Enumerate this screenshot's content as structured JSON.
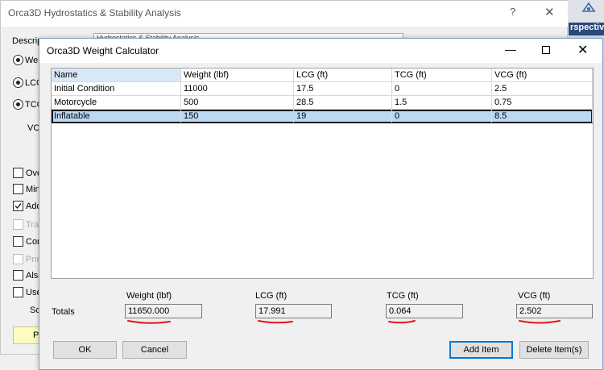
{
  "background_window": {
    "title": "Orca3D Hydrostatics & Stability Analysis",
    "help_glyph": "?",
    "close_glyph": "✕",
    "description_label": "Descrip",
    "description_value": "Hydrostatics & Stability Analysis",
    "radios": [
      "Wei",
      "LCG",
      "TCG"
    ],
    "vc_label": "VC",
    "checkboxes": [
      {
        "label": "Ove",
        "disabled": false,
        "checked": false
      },
      {
        "label": "Mini",
        "disabled": false,
        "checked": false
      },
      {
        "label": "Add",
        "disabled": false,
        "checked": true
      },
      {
        "label": "Tra",
        "disabled": true,
        "checked": false
      },
      {
        "label": "Con",
        "disabled": false,
        "checked": false
      },
      {
        "label": "Prin",
        "disabled": true,
        "checked": false
      },
      {
        "label": "Also",
        "disabled": false,
        "checked": false
      },
      {
        "label": "Use",
        "disabled": false,
        "checked": false
      }
    ],
    "so_label": "So",
    "yellow_button_label": "Pe"
  },
  "side_app": {
    "tab_label": "rspectiv",
    "icon": "app-tool-icon"
  },
  "dialog": {
    "title": "Orca3D Weight Calculator",
    "minimize_glyph": "—",
    "close_glyph": "✕",
    "table": {
      "headers": [
        "Name",
        "Weight (lbf)",
        "LCG (ft)",
        "TCG (ft)",
        "VCG (ft)"
      ],
      "rows": [
        [
          "Initial Condition",
          "11000",
          "17.5",
          "0",
          "2.5"
        ],
        [
          "Motorcycle",
          "500",
          "28.5",
          "1.5",
          "0.75"
        ],
        [
          "Inflatable",
          "150",
          "19",
          "0",
          "8.5"
        ]
      ],
      "selected_row": 2
    },
    "totals": {
      "label": "Totals",
      "weight_label": "Weight (lbf)",
      "weight_value": "11650.000",
      "lcg_label": "LCG (ft)",
      "lcg_value": "17.991",
      "tcg_label": "TCG (ft)",
      "tcg_value": "0.064",
      "vcg_label": "VCG (ft)",
      "vcg_value": "2.502",
      "annotation_color": "#e8121a"
    },
    "buttons": {
      "ok": "OK",
      "cancel": "Cancel",
      "add_item": "Add Item",
      "delete_items": "Delete Item(s)"
    }
  }
}
